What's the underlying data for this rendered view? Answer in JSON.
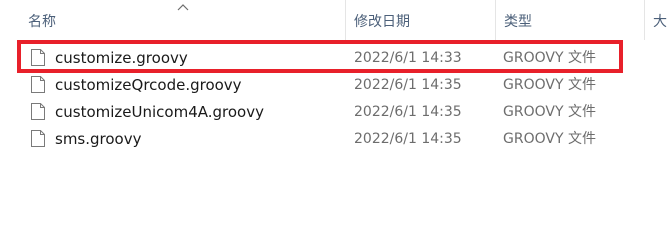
{
  "columns": {
    "name": "名称",
    "date": "修改日期",
    "type": "类型",
    "size": "大"
  },
  "sort": {
    "column": "name",
    "icon": "chevron-up-icon"
  },
  "files": [
    {
      "name": "customize.groovy",
      "modified": "2022/6/1 14:33",
      "type": "GROOVY 文件",
      "icon": "file-icon",
      "highlighted": true
    },
    {
      "name": "customizeQrcode.groovy",
      "modified": "2022/6/1 14:35",
      "type": "GROOVY 文件",
      "icon": "file-icon",
      "highlighted": false
    },
    {
      "name": "customizeUnicom4A.groovy",
      "modified": "2022/6/1 14:35",
      "type": "GROOVY 文件",
      "icon": "file-icon",
      "highlighted": false
    },
    {
      "name": "sms.groovy",
      "modified": "2022/6/1 14:35",
      "type": "GROOVY 文件",
      "icon": "file-icon",
      "highlighted": false
    }
  ],
  "colors": {
    "highlight_border": "#e8202a",
    "header_text": "#4c607a",
    "secondary_text": "#6d6d6d"
  }
}
